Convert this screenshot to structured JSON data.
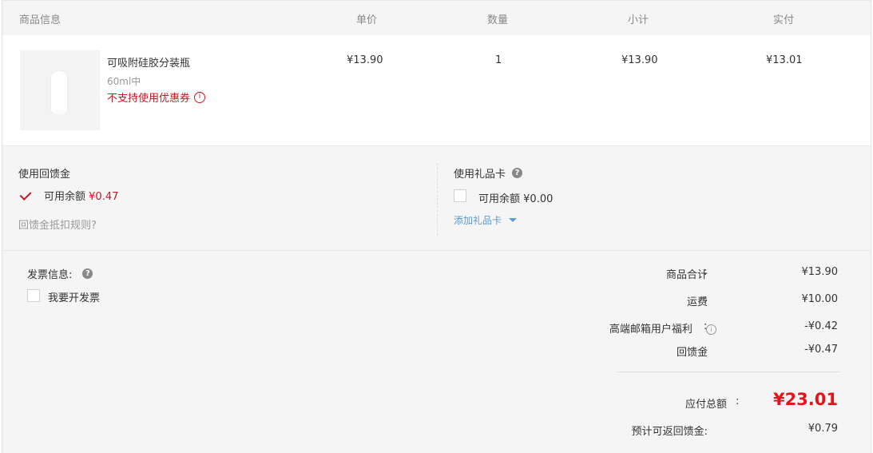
{
  "header": {
    "product_info": "商品信息",
    "unit_price": "单价",
    "quantity": "数量",
    "subtotal": "小计",
    "actual_paid": "实付"
  },
  "product": {
    "name": "可吸附硅胶分装瓶",
    "spec": "60ml中",
    "coupon_warning": "不支持使用优惠券",
    "unit_price": "¥13.90",
    "quantity": "1",
    "subtotal": "¥13.90",
    "actual_paid": "¥13.01"
  },
  "cashback": {
    "title": "使用回馈金",
    "checked": true,
    "balance_label": "可用余额",
    "balance_value": "¥0.47",
    "rules_link": "回馈金抵扣规则?"
  },
  "gift_card": {
    "title": "使用礼品卡",
    "checked": false,
    "balance_label": "可用余额",
    "balance_value": "¥0.00",
    "add_link": "添加礼品卡"
  },
  "invoice": {
    "title": "发票信息:",
    "checkbox_label": "我要开发票",
    "checked": false
  },
  "summary": {
    "items_total_label": "商品合计",
    "items_total": "¥13.90",
    "shipping_label": "运费",
    "shipping": "¥10.00",
    "premium_label": "高端邮箱用户福利",
    "premium": "-¥0.42",
    "cashback_label": "回馈金",
    "cashback": "-¥0.47",
    "colon": ":",
    "total_label": "应付总额",
    "total": "¥23.01",
    "expected_cashback_label": "预计可返回馈金:",
    "expected_cashback": "¥0.79"
  },
  "colors": {
    "accent_red": "#c81623",
    "total_red": "#e4141c",
    "link_blue": "#5b9bd1"
  }
}
